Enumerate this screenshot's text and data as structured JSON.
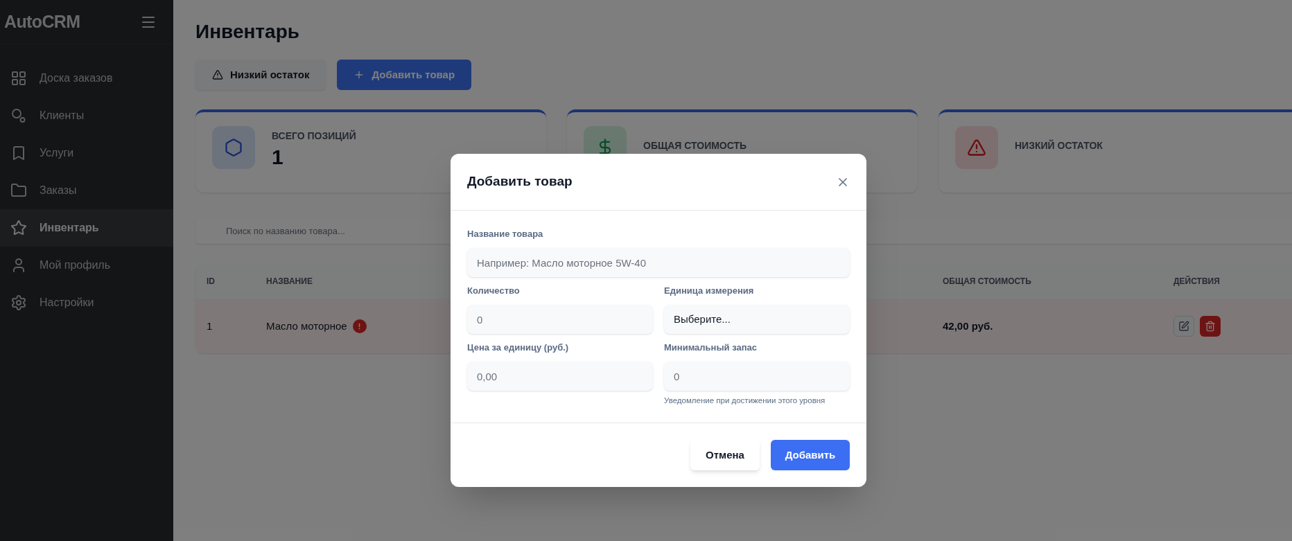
{
  "sidebar": {
    "logo": "AutoCRM",
    "items": [
      {
        "label": "Доска заказов",
        "selected": false
      },
      {
        "label": "Клиенты",
        "selected": false
      },
      {
        "label": "Услуги",
        "selected": false
      },
      {
        "label": "Заказы",
        "selected": false
      },
      {
        "label": "Инвентарь",
        "selected": true
      },
      {
        "label": "Мой профиль",
        "selected": false
      },
      {
        "label": "Настройки",
        "selected": false
      }
    ]
  },
  "page": {
    "title": "Инвентарь",
    "actions": [
      {
        "label": "Низкий остаток",
        "kind": "secondary"
      },
      {
        "label": "Добавить товар",
        "kind": "primary"
      }
    ]
  },
  "stats": [
    {
      "label": "ВСЕГО ПОЗИЦИЙ",
      "value": "1",
      "kind": "hexagon"
    },
    {
      "label": "ОБЩАЯ СТОИМОСТЬ",
      "kind": "dollar"
    },
    {
      "label": "НИЗКИЙ ОСТАТОК",
      "kind": "warning"
    }
  ],
  "search": {
    "placeholder": "Поиск по названию товара..."
  },
  "table": {
    "columns": [
      {
        "label": "ID"
      },
      {
        "label": "НАЗВАНИЕ"
      },
      {
        "label": "ОБЩАЯ СТОИМОСТЬ"
      },
      {
        "label": "ДЕЙСТВИЯ"
      }
    ],
    "rows": [
      {
        "id": "1",
        "name": "Масло моторное",
        "low_stock": true,
        "total": "42,00 руб."
      }
    ]
  },
  "dialog": {
    "title": "Добавить товар",
    "fields": [
      {
        "label": "Название товара",
        "placeholder": "Например: Масло моторное 5W-40",
        "kind": "text"
      },
      {
        "label": "Количество",
        "placeholder": "0",
        "kind": "text"
      },
      {
        "label": "Единица измерения",
        "value": "Выберите...",
        "kind": "select"
      },
      {
        "label": "Цена за единицу (руб.)",
        "placeholder": "0,00",
        "kind": "text"
      },
      {
        "label": "Минимальный запас",
        "placeholder": "0",
        "kind": "text",
        "hint": "Уведомление при достижении этого уровня"
      }
    ],
    "buttons": [
      {
        "label": "Отмена",
        "kind": "secondary"
      },
      {
        "label": "Добавить",
        "kind": "primary"
      }
    ]
  }
}
